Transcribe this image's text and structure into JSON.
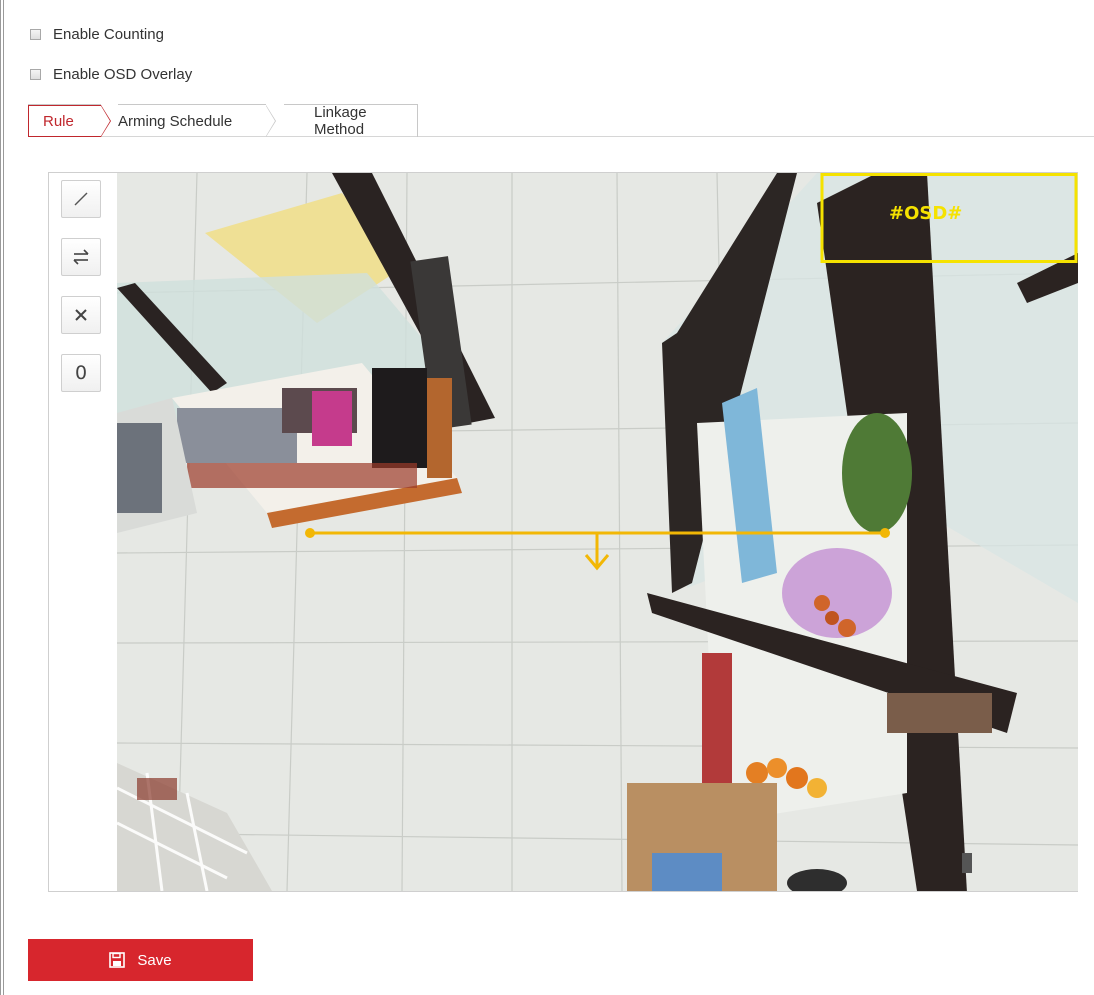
{
  "options": {
    "enable_counting_label": "Enable Counting",
    "enable_osd_label": "Enable OSD Overlay"
  },
  "tabs": [
    {
      "label": "Rule"
    },
    {
      "label": "Arming Schedule"
    },
    {
      "label": "Linkage Method"
    }
  ],
  "toolbar": {
    "draw_line_icon": "line-icon",
    "swap_direction_icon": "swap-direction-icon",
    "clear_icon": "close-icon",
    "count_value": "0"
  },
  "video": {
    "osd_label": "#OSD#",
    "osd_color": "#f5e200",
    "line_color": "#f2b705"
  },
  "actions": {
    "save_label": "Save"
  },
  "colors": {
    "accent": "#d7262d",
    "active_tab_text": "#c0272d"
  }
}
